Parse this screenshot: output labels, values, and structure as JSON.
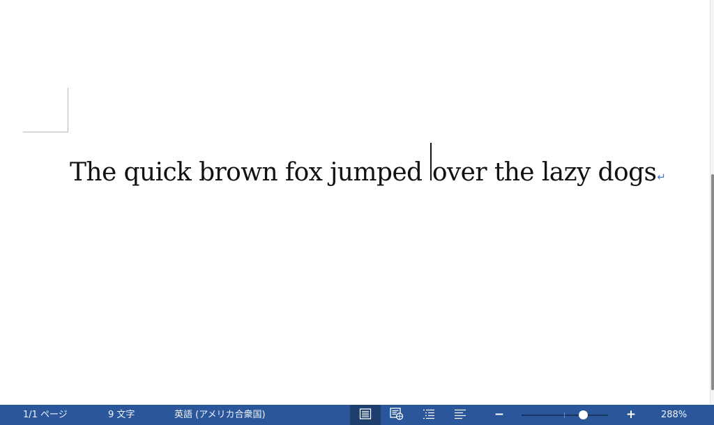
{
  "document": {
    "text_before_caret": "The quick brown fox jumped ",
    "text_after_caret": "over the lazy dogs",
    "paragraph_mark": "↵"
  },
  "status_bar": {
    "page_count": "1/1 ページ",
    "word_count": "9 文字",
    "language": "英語 (アメリカ合衆国)",
    "view_buttons": [
      {
        "name": "print-layout",
        "icon": "print-layout-icon",
        "active": true
      },
      {
        "name": "web-layout",
        "icon": "web-layout-icon",
        "active": false
      },
      {
        "name": "outline",
        "icon": "outline-icon",
        "active": false
      },
      {
        "name": "draft",
        "icon": "draft-icon",
        "active": false
      }
    ],
    "zoom_out_label": "−",
    "zoom_in_label": "+",
    "zoom_level": "288%",
    "zoom_slider_fraction": 0.71
  },
  "colors": {
    "status_bar_bg": "#2b579a",
    "active_view_bg": "#1e3e6e",
    "paragraph_mark": "#3a78d6",
    "text": "#111111"
  }
}
